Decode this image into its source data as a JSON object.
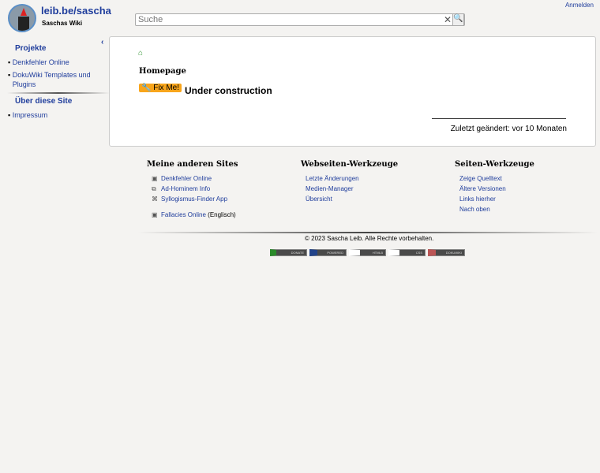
{
  "header": {
    "title": "leib.be/sascha",
    "subtitle": "Saschas Wiki",
    "login": "Anmelden",
    "search_placeholder": "Suche"
  },
  "sidebar": {
    "sections": [
      {
        "title": "Projekte",
        "items": [
          "Denkfehler Online",
          "DokuWiki Templates und Plugins"
        ]
      },
      {
        "title": "Über diese Site",
        "items": [
          "Impressum"
        ]
      }
    ]
  },
  "page": {
    "title": "Homepage",
    "fixme": "🔧 Fix Me!",
    "text": "Under construction",
    "last_changed": "Zuletzt geändert: vor 10 Monaten"
  },
  "footer": {
    "cols": [
      {
        "title": "Meine anderen Sites",
        "items": [
          "Denkfehler Online",
          "Ad-Hominem Info",
          "Syllogismus-Finder App",
          "Fallacies Online"
        ],
        "suffix": "(Englisch)"
      },
      {
        "title": "Webseiten-Werkzeuge",
        "items": [
          "Letzte Änderungen",
          "Medien-Manager",
          "Übersicht"
        ]
      },
      {
        "title": "Seiten-Werkzeuge",
        "items": [
          "Zeige Quelltext",
          "Ältere Versionen",
          "Links hierher",
          "Nach oben"
        ]
      }
    ],
    "copyright": "© 2023 Sascha Leib. Alle Rechte vorbehalten.",
    "badges": [
      "DONATE",
      "POWERED",
      "HTML5",
      "CSS",
      "DOKUWIKI"
    ]
  }
}
